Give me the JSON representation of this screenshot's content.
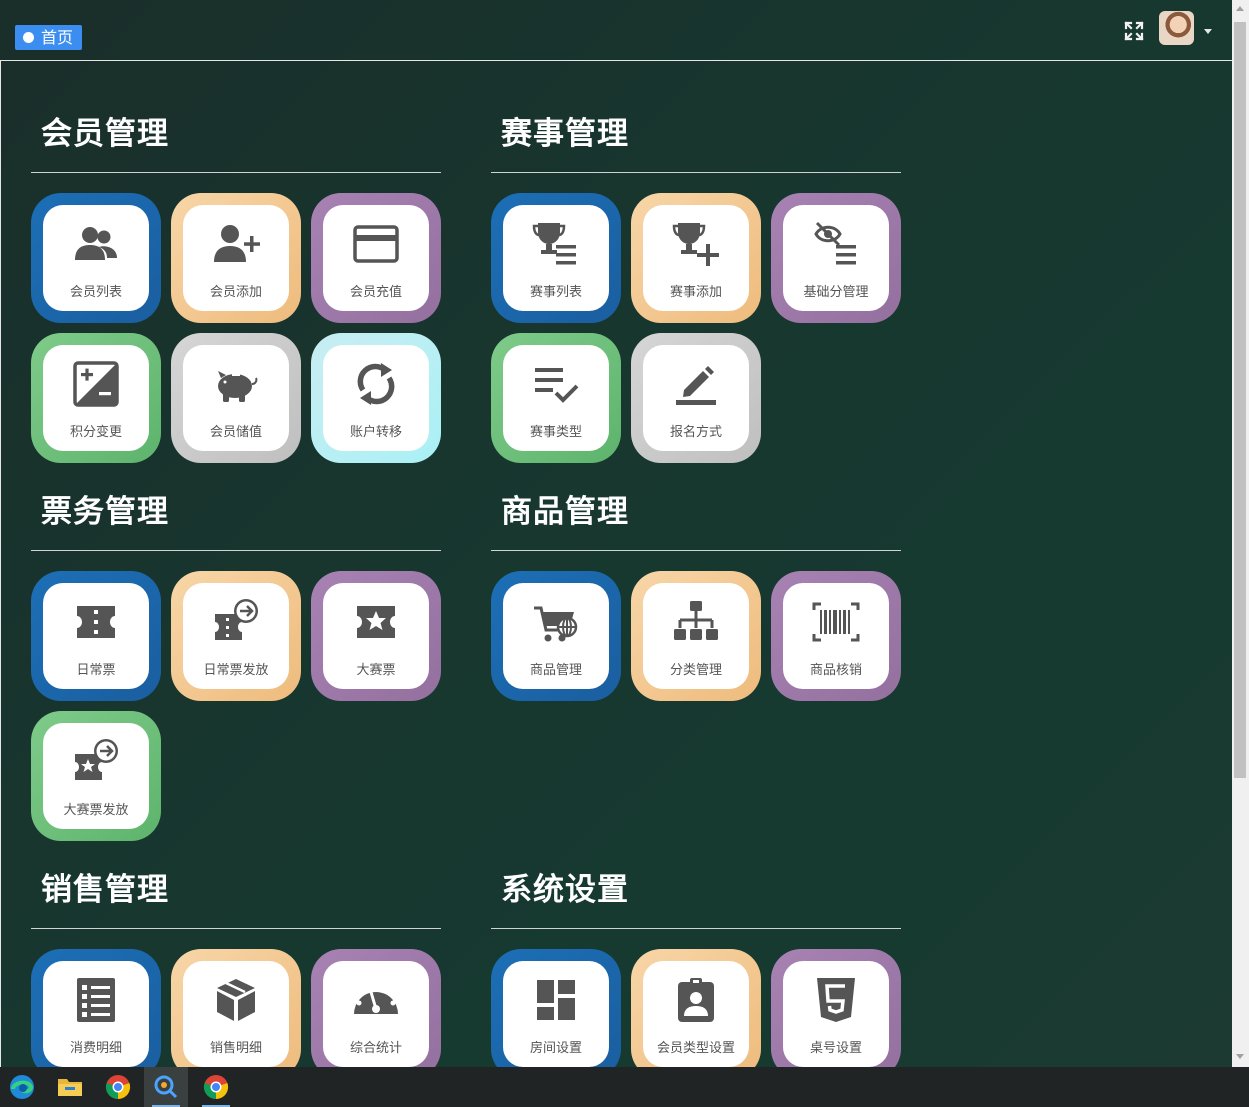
{
  "header": {
    "home_tab": "首页"
  },
  "sections": [
    {
      "title": "会员管理",
      "items": [
        {
          "label": "会员列表",
          "icon": "users-icon",
          "color": "blue"
        },
        {
          "label": "会员添加",
          "icon": "user-plus-icon",
          "color": "orange"
        },
        {
          "label": "会员充值",
          "icon": "credit-card-icon",
          "color": "purple"
        },
        {
          "label": "积分变更",
          "icon": "plus-minus-icon",
          "color": "green"
        },
        {
          "label": "会员储值",
          "icon": "piggy-bank-icon",
          "color": "grey"
        },
        {
          "label": "账户转移",
          "icon": "sync-icon",
          "color": "cyan"
        }
      ]
    },
    {
      "title": "赛事管理",
      "items": [
        {
          "label": "赛事列表",
          "icon": "trophy-list-icon",
          "color": "blue"
        },
        {
          "label": "赛事添加",
          "icon": "trophy-plus-icon",
          "color": "orange"
        },
        {
          "label": "基础分管理",
          "icon": "eye-off-list-icon",
          "color": "purple"
        },
        {
          "label": "赛事类型",
          "icon": "list-check-icon",
          "color": "green"
        },
        {
          "label": "报名方式",
          "icon": "edit-pen-icon",
          "color": "grey"
        }
      ]
    },
    {
      "title": "票务管理",
      "items": [
        {
          "label": "日常票",
          "icon": "ticket-icon",
          "color": "blue"
        },
        {
          "label": "日常票发放",
          "icon": "ticket-send-icon",
          "color": "orange"
        },
        {
          "label": "大赛票",
          "icon": "star-ticket-icon",
          "color": "purple"
        },
        {
          "label": "大赛票发放",
          "icon": "star-ticket-send-icon",
          "color": "green"
        }
      ]
    },
    {
      "title": "商品管理",
      "items": [
        {
          "label": "商品管理",
          "icon": "cart-globe-icon",
          "color": "blue"
        },
        {
          "label": "分类管理",
          "icon": "sitemap-icon",
          "color": "orange"
        },
        {
          "label": "商品核销",
          "icon": "barcode-scan-icon",
          "color": "purple"
        }
      ]
    },
    {
      "title": "销售管理",
      "items": [
        {
          "label": "消费明细",
          "icon": "list-detail-icon",
          "color": "blue"
        },
        {
          "label": "销售明细",
          "icon": "cube-icon",
          "color": "orange"
        },
        {
          "label": "综合统计",
          "icon": "gauge-icon",
          "color": "purple"
        }
      ]
    },
    {
      "title": "系统设置",
      "items": [
        {
          "label": "房间设置",
          "icon": "dashboard-layout-icon",
          "color": "blue"
        },
        {
          "label": "会员类型设置",
          "icon": "badge-id-icon",
          "color": "orange"
        },
        {
          "label": "桌号设置",
          "icon": "html5-icon",
          "color": "purple"
        }
      ]
    }
  ],
  "taskbar": {
    "apps": [
      "edge-icon",
      "file-explorer-icon",
      "chrome-icon",
      "app-icon",
      "chrome-icon"
    ]
  }
}
